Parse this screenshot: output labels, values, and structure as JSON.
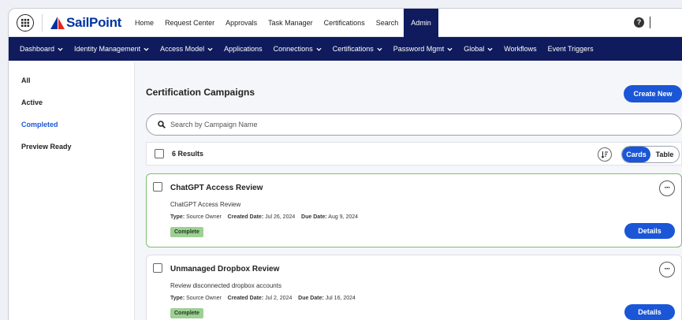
{
  "brand": {
    "name": "SailPoint",
    "color": "#0033a1"
  },
  "topnav": {
    "items": [
      "Home",
      "Request Center",
      "Approvals",
      "Task Manager",
      "Certifications",
      "Search",
      "Admin"
    ],
    "active": "Admin",
    "help_icon": "help-icon",
    "help_glyph": "?",
    "help_separator": "|"
  },
  "subnav": {
    "items": [
      {
        "label": "Dashboard",
        "dropdown": true
      },
      {
        "label": "Identity Management",
        "dropdown": true
      },
      {
        "label": "Access Model",
        "dropdown": true
      },
      {
        "label": "Applications",
        "dropdown": false
      },
      {
        "label": "Connections",
        "dropdown": true
      },
      {
        "label": "Certifications",
        "dropdown": true
      },
      {
        "label": "Password Mgmt",
        "dropdown": true
      },
      {
        "label": "Global",
        "dropdown": true
      },
      {
        "label": "Workflows",
        "dropdown": false
      },
      {
        "label": "Event Triggers",
        "dropdown": false
      }
    ]
  },
  "sidebar": {
    "items": [
      {
        "label": "All"
      },
      {
        "label": "Active"
      },
      {
        "label": "Completed"
      },
      {
        "label": "Preview Ready"
      }
    ],
    "active": "Completed"
  },
  "main": {
    "title": "Certification Campaigns",
    "create_label": "Create New",
    "search_placeholder": "Search by Campaign Name",
    "results_label": "6 Results",
    "view_options": [
      "Cards",
      "Table"
    ],
    "view_selected": "Cards"
  },
  "cards": [
    {
      "title": "ChatGPT Access Review",
      "description": "ChatGPT Access Review",
      "type_label": "Type:",
      "type_value": "Source Owner",
      "created_label": "Created Date:",
      "created_value": "Jul 26, 2024",
      "due_label": "Due Date:",
      "due_value": "Aug 9, 2024",
      "status": "Complete",
      "details_label": "Details",
      "more_glyph": "···"
    },
    {
      "title": "Unmanaged Dropbox Review",
      "description": "Review disconnected dropbox accounts",
      "type_label": "Type:",
      "type_value": "Source Owner",
      "created_label": "Created Date:",
      "created_value": "Jul 2, 2024",
      "due_label": "Due Date:",
      "due_value": "Jul 16, 2024",
      "status": "Complete",
      "details_label": "Details",
      "more_glyph": "···"
    }
  ],
  "colors": {
    "primary": "#1a56d6",
    "navbar": "#0f1b5c",
    "status_complete": "#9ecf95",
    "selected_border": "#7cbd74"
  }
}
